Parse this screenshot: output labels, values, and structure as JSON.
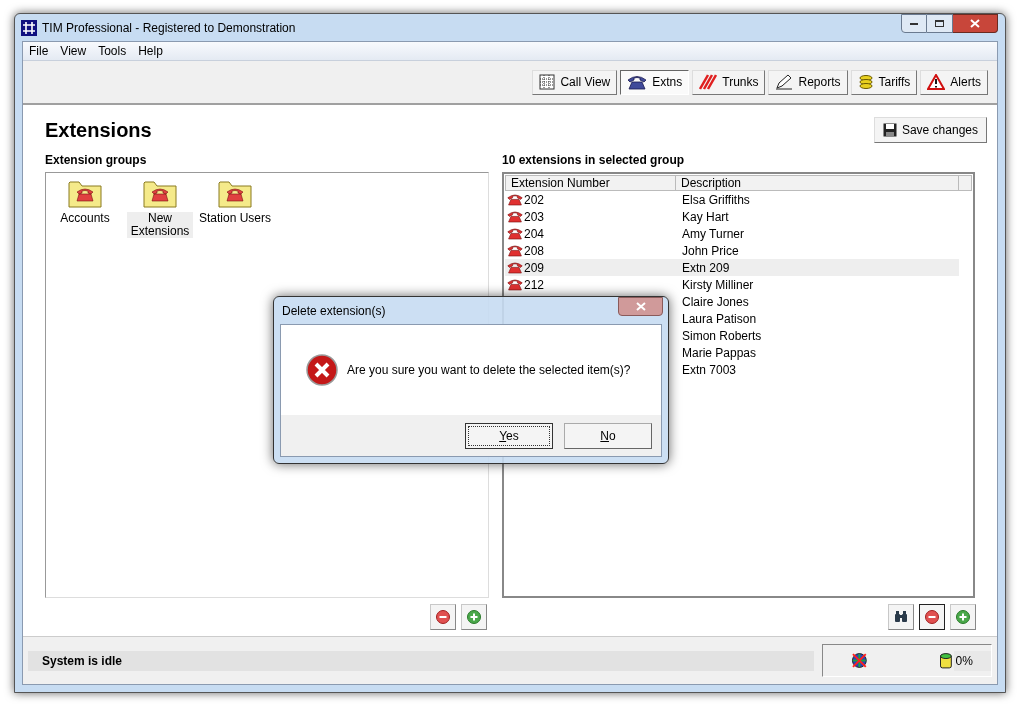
{
  "window": {
    "title": "TIM Professional - Registered to Demonstration"
  },
  "menu": [
    "File",
    "View",
    "Tools",
    "Help"
  ],
  "toolbar": [
    {
      "label": "Call View",
      "kind": "calls",
      "selected": false
    },
    {
      "label": "Extns",
      "kind": "phone",
      "selected": true
    },
    {
      "label": "Trunks",
      "kind": "trunks",
      "selected": false
    },
    {
      "label": "Reports",
      "kind": "reports",
      "selected": false
    },
    {
      "label": "Tariffs",
      "kind": "coins",
      "selected": false
    },
    {
      "label": "Alerts",
      "kind": "alert",
      "selected": false
    }
  ],
  "heading": "Extensions",
  "save_button": "Save changes",
  "groups": {
    "title": "Extension groups",
    "items": [
      {
        "label": "Accounts",
        "selected": false
      },
      {
        "label": "New Extensions",
        "selected": true
      },
      {
        "label": "Station Users",
        "selected": false
      }
    ]
  },
  "extensions": {
    "title": "10 extensions in selected group",
    "columns": [
      "Extension Number",
      "Description"
    ],
    "rows": [
      {
        "number": "202",
        "description": "Elsa Griffiths",
        "selected": false
      },
      {
        "number": "203",
        "description": "Kay Hart",
        "selected": false
      },
      {
        "number": "204",
        "description": "Amy Turner",
        "selected": false
      },
      {
        "number": "208",
        "description": "John Price",
        "selected": false
      },
      {
        "number": "209",
        "description": "Extn 209",
        "selected": true
      },
      {
        "number": "212",
        "description": "Kirsty Milliner",
        "selected": false
      },
      {
        "description": "Claire Jones",
        "selected": false
      },
      {
        "description": "Laura Patison",
        "selected": false
      },
      {
        "description": "Simon Roberts",
        "selected": false
      },
      {
        "description": "Marie Pappas",
        "selected": false
      },
      {
        "description": "Extn 7003",
        "selected": false
      }
    ]
  },
  "status_bar": {
    "message": "System is idle",
    "percent": "0%"
  },
  "dialog": {
    "title": "Delete extension(s)",
    "message": "Are you sure you want to delete the selected item(s)?",
    "buttons": [
      {
        "label": "Yes",
        "focused": true
      },
      {
        "label": "No",
        "focused": false
      }
    ]
  }
}
